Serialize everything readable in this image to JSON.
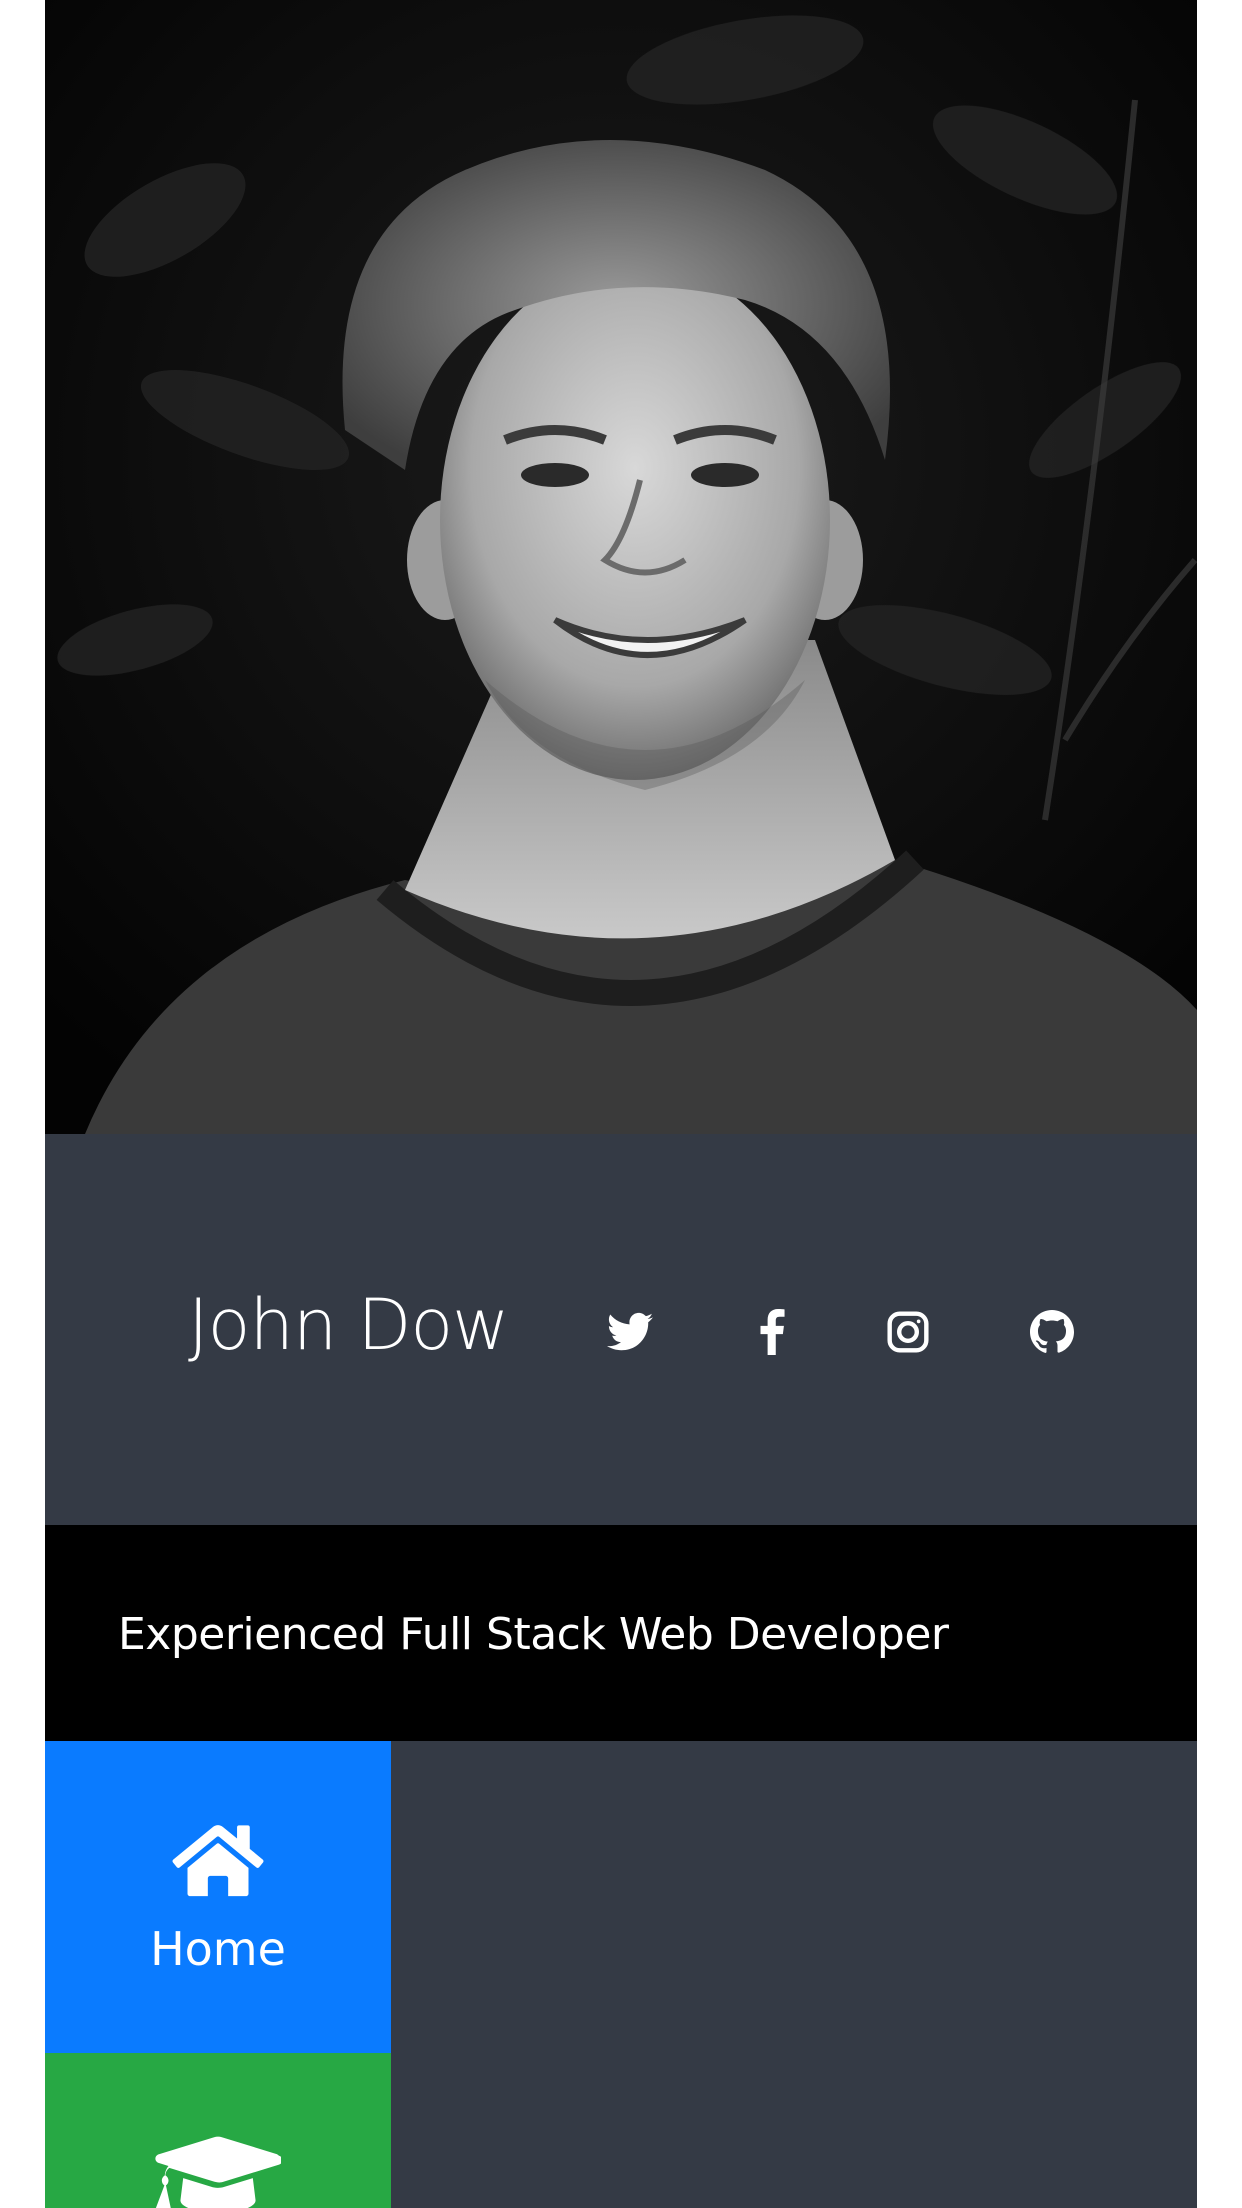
{
  "profile": {
    "photo_alt": "Portrait photo",
    "name": "John Dow",
    "tagline": "Experienced Full Stack Web Developer"
  },
  "social": [
    {
      "icon": "twitter-icon"
    },
    {
      "icon": "facebook-icon"
    },
    {
      "icon": "instagram-icon"
    },
    {
      "icon": "github-icon"
    }
  ],
  "nav": {
    "home_label": "Home",
    "education_label": ""
  },
  "colors": {
    "bar_dark": "#343a45",
    "tagline_bg": "#000000",
    "home_tile": "#0a7bff",
    "education_tile": "#27a844"
  }
}
